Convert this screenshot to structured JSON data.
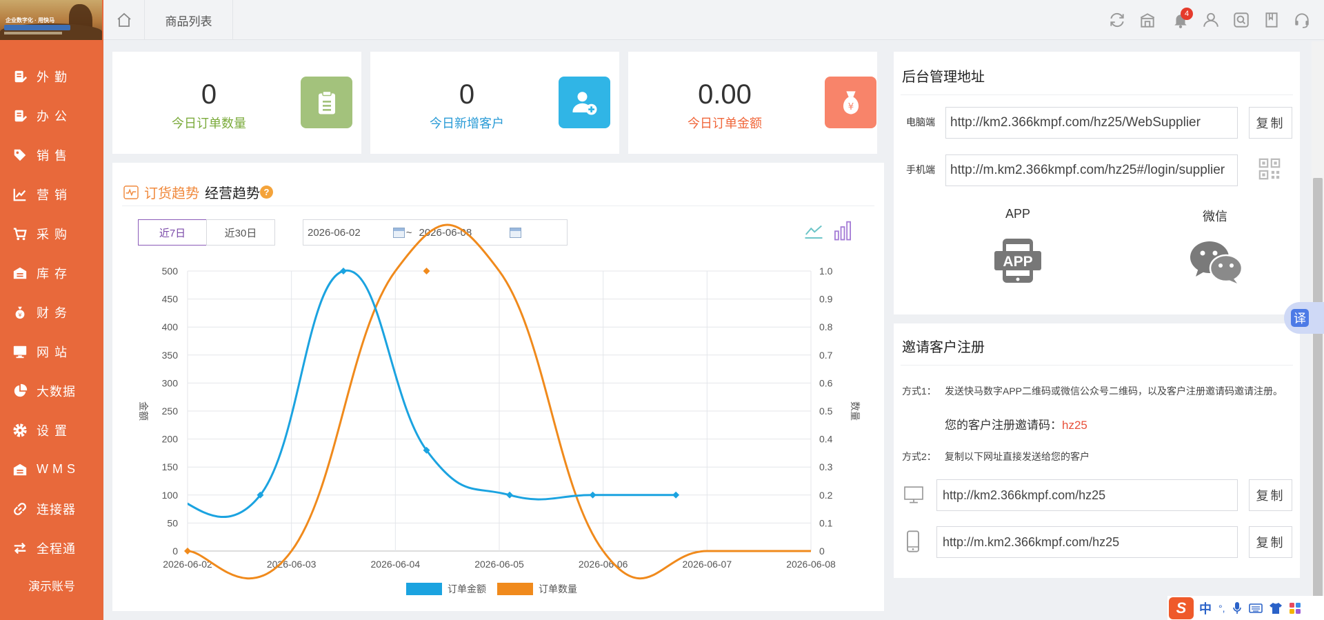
{
  "topbar": {
    "tab_label": "商品列表",
    "notifications_count": "4"
  },
  "sidebar": {
    "logo_slogan": "企业数字化 · 用快马",
    "items": [
      {
        "label": "外勤",
        "icon": "clipboard-edit-icon"
      },
      {
        "label": "办公",
        "icon": "clipboard-edit-icon"
      },
      {
        "label": "销售",
        "icon": "tag-icon"
      },
      {
        "label": "营销",
        "icon": "chart-up-icon"
      },
      {
        "label": "采购",
        "icon": "cart-icon"
      },
      {
        "label": "库存",
        "icon": "warehouse-icon"
      },
      {
        "label": "财务",
        "icon": "money-bag-icon"
      },
      {
        "label": "网站",
        "icon": "monitor-icon"
      },
      {
        "label": "大数据",
        "icon": "pie-chart-icon"
      },
      {
        "label": "设置",
        "icon": "gear-icon"
      },
      {
        "label": "WMS",
        "icon": "warehouse-icon"
      },
      {
        "label": "连接器",
        "icon": "link-icon"
      },
      {
        "label": "全程通",
        "icon": "transfer-icon"
      }
    ],
    "demo_account": "演示账号"
  },
  "stats": [
    {
      "value": "0",
      "label": "今日订单数量",
      "color": "#7bab3c",
      "icon": "clipboard-icon",
      "icon_bg": "#a3c27c"
    },
    {
      "value": "0",
      "label": "今日新增客户",
      "color": "#2a9bd6",
      "icon": "add-user-icon",
      "icon_bg": "#30b5e6"
    },
    {
      "value": "0.00",
      "label": "今日订单金额",
      "color": "#f0663a",
      "icon": "money-bag-icon",
      "icon_bg": "#f8846a"
    }
  ],
  "trend": {
    "title_active": "订货趋势",
    "title_other": "经营趋势",
    "range_7": "近7日",
    "range_30": "近30日",
    "date_from": "2026-06-02",
    "date_sep": "~",
    "date_to": "2026-06-08"
  },
  "chart_data": {
    "type": "line",
    "x": [
      "2026-06-02",
      "2026-06-03",
      "2026-06-04",
      "2026-06-05",
      "2026-06-06",
      "2026-06-07",
      "2026-06-08"
    ],
    "y_left_label": "金额",
    "y_right_label": "数量",
    "y_left_range": [
      0,
      500
    ],
    "y_left_ticks": [
      0,
      50,
      100,
      150,
      200,
      250,
      300,
      350,
      400,
      450,
      500
    ],
    "y_right_range": [
      0,
      1.0
    ],
    "y_right_ticks": [
      "0",
      "0.1",
      "0.2",
      "0.3",
      "0.4",
      "0.5",
      "0.6",
      "0.7",
      "0.8",
      "0.9",
      "1.0"
    ],
    "series": [
      {
        "name": "订单金额",
        "axis": "left",
        "color": "#1ba3e0",
        "points": [
          [
            -0.2,
            100
          ],
          [
            0.7,
            100
          ],
          [
            1.5,
            500
          ],
          [
            2.3,
            180
          ],
          [
            3.1,
            100
          ],
          [
            3.9,
            100
          ],
          [
            4.7,
            100
          ]
        ]
      },
      {
        "name": "订单数量",
        "axis": "right",
        "color": "#f08a1c",
        "points": [
          [
            0.0,
            0.0
          ],
          [
            1.0,
            0.0
          ],
          [
            2.0,
            1.0
          ],
          [
            3.0,
            1.0
          ],
          [
            4.0,
            0.0
          ],
          [
            5.0,
            0.0
          ],
          [
            6.0,
            0.0
          ]
        ],
        "markers_at": [
          [
            0.0,
            0.0
          ],
          [
            2.3,
            1.0
          ]
        ]
      }
    ],
    "legend_position": "bottom-center",
    "grid": true
  },
  "admin": {
    "title": "后台管理地址",
    "pc_label": "电脑端",
    "pc_url": "http://km2.366kmpf.com/hz25/WebSupplier",
    "mobile_label": "手机端",
    "mobile_url": "http://m.km2.366kmpf.com/hz25#/login/supplier",
    "copy_label": "复制",
    "app_label": "APP",
    "app_icon_text": "APP",
    "wechat_label": "微信"
  },
  "invite": {
    "title": "邀请客户注册",
    "method1_label": "方式1：",
    "method1_text": "发送快马数字APP二维码或微信公众号二维码，以及客户注册邀请码邀请注册。",
    "code_label": "您的客户注册邀请码：",
    "code": "hz25",
    "method2_label": "方式2：",
    "method2_text": "复制以下网址直接发送给您的客户",
    "pc_url": "http://km2.366kmpf.com/hz25",
    "mobile_url": "http://m.km2.366kmpf.com/hz25",
    "copy_label": "复制"
  },
  "translate_label": "译",
  "ime": {
    "brand": "S",
    "lang": "中"
  }
}
